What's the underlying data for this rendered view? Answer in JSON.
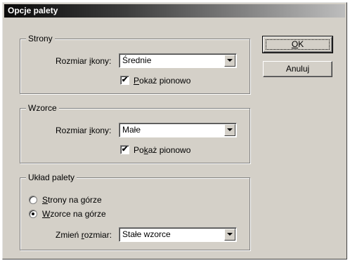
{
  "window": {
    "title": "Opcje palety"
  },
  "strony": {
    "legend": "Strony",
    "size_label_pre": "Rozmiar ",
    "size_label_key": "i",
    "size_label_post": "kony:",
    "size_value": "Średnie",
    "vertical_checked": true,
    "vertical_key": "P",
    "vertical_rest": "okaż pionowo"
  },
  "wzorce": {
    "legend": "Wzorce",
    "size_label_pre": "Rozmiar ",
    "size_label_key": "i",
    "size_label_post": "kony:",
    "size_value": "Małe",
    "vertical_checked": true,
    "vertical_pre": "Po",
    "vertical_key": "k",
    "vertical_post": "aż pionowo"
  },
  "uklad": {
    "legend": "Układ palety",
    "opt1_key": "S",
    "opt1_rest": "trony na górze",
    "opt1_selected": false,
    "opt2_key": "W",
    "opt2_rest": "zorce na górze",
    "opt2_selected": true,
    "resize_pre": "Zmień ",
    "resize_key": "r",
    "resize_post": "ozmiar:",
    "resize_value": "Stałe wzorce"
  },
  "buttons": {
    "ok_key": "O",
    "ok_rest": "K",
    "cancel": "Anuluj"
  },
  "icons": {
    "checkmark": "✔",
    "dropdown": "chevron-down-icon"
  }
}
